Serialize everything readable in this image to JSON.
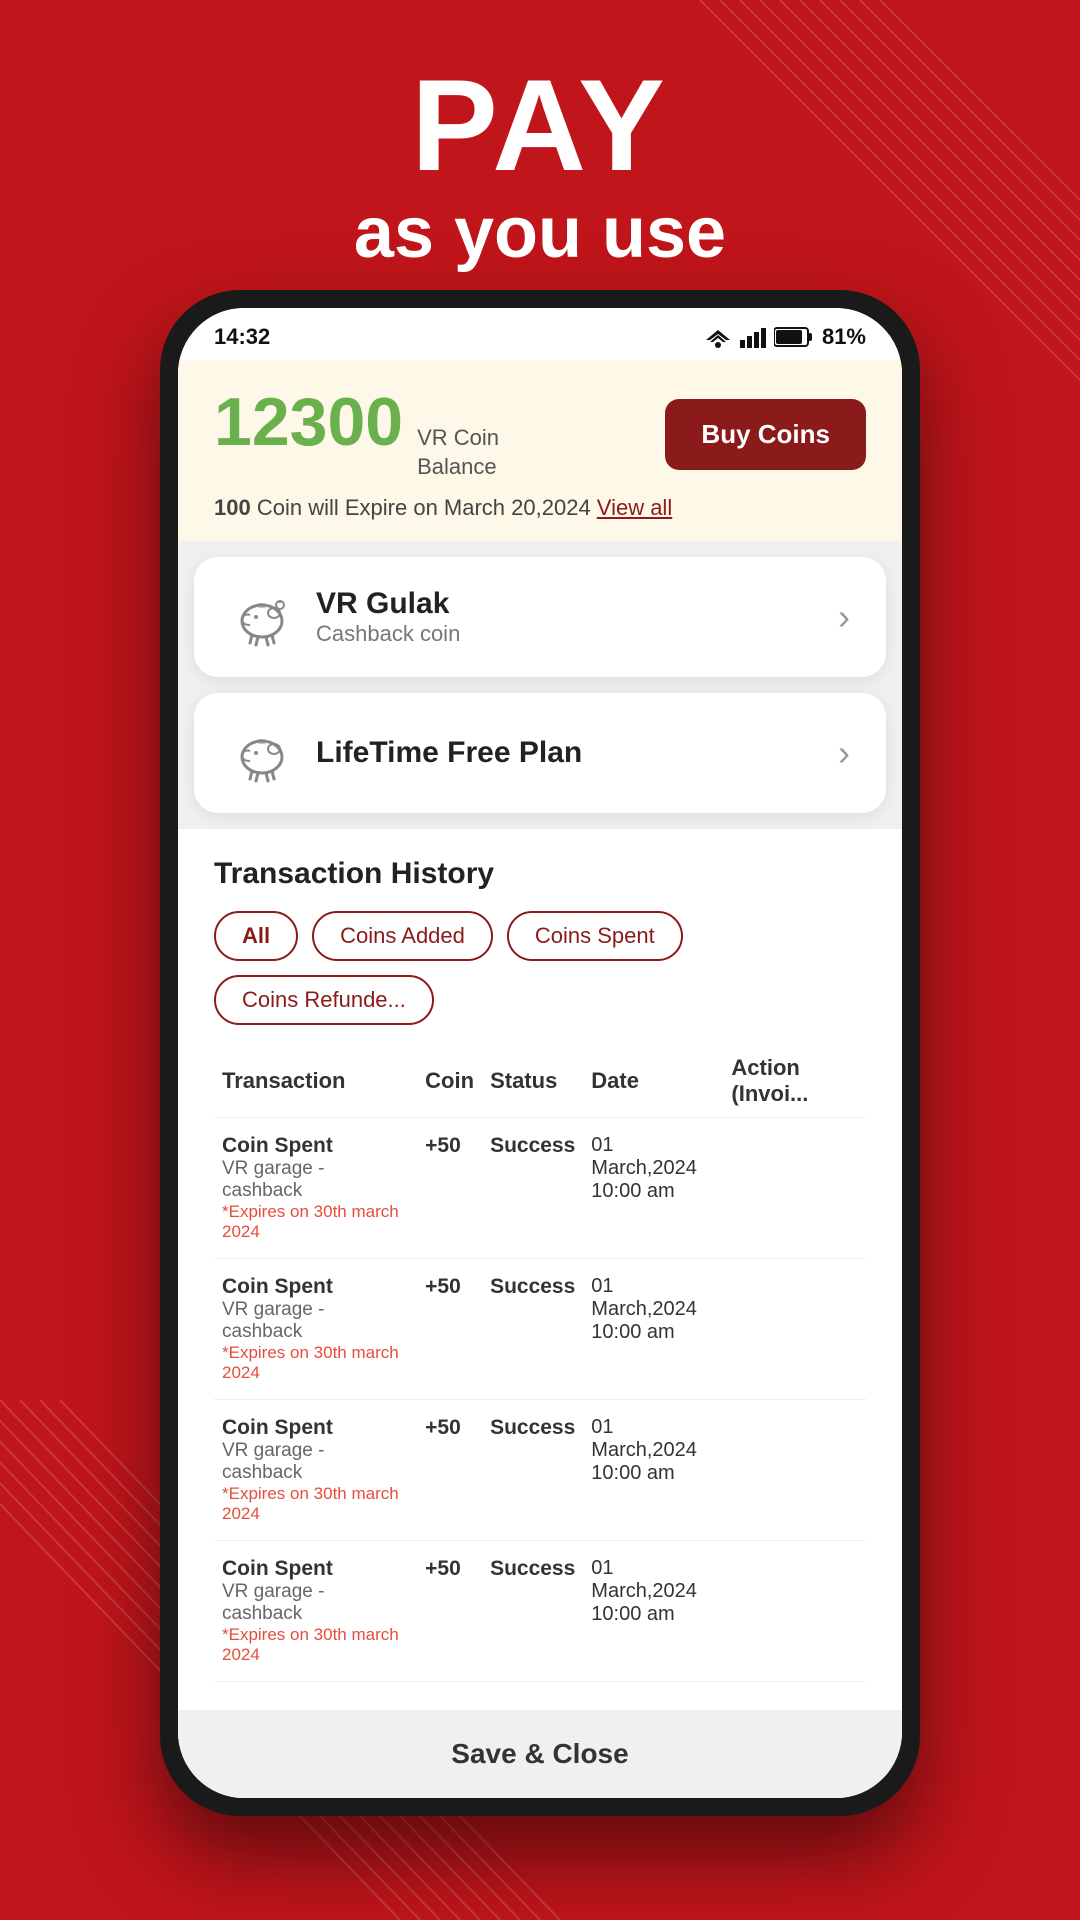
{
  "background": {
    "color": "#c0151a"
  },
  "header": {
    "pay_label": "PAY",
    "subtitle": "as you use"
  },
  "status_bar": {
    "time": "14:32",
    "battery": "81%"
  },
  "coin_balance": {
    "amount": "12300",
    "label_line1": "VR Coin",
    "label_line2": "Balance",
    "buy_coins_label": "Buy Coins",
    "expiry_text_prefix": "100",
    "expiry_text_main": " Coin will Expire on March 20,2024 ",
    "view_all_label": "View all"
  },
  "vr_gulak": {
    "title": "VR Gulak",
    "subtitle": "Cashback coin"
  },
  "lifetime_plan": {
    "title_prefix": "LifeTime ",
    "title_bold": "Free",
    "title_suffix": " Plan"
  },
  "transaction_history": {
    "title": "Transaction History",
    "filters": [
      {
        "label": "All",
        "active": true
      },
      {
        "label": "Coins Added",
        "active": false
      },
      {
        "label": "Coins Spent",
        "active": false
      },
      {
        "label": "Coins Refunde...",
        "active": false
      }
    ],
    "table_headers": {
      "transaction": "Transaction",
      "coin": "Coin",
      "status": "Status",
      "date": "Date",
      "action": "Action (Invoi..."
    },
    "rows": [
      {
        "name": "Coin Spent",
        "sub": "VR garage - cashback",
        "expiry": "*Expires on 30th march 2024",
        "coin": "+50",
        "status": "Success",
        "date": "01 March,2024",
        "time": "10:00 am"
      },
      {
        "name": "Coin Spent",
        "sub": "VR garage - cashback",
        "expiry": "*Expires on 30th march 2024",
        "coin": "+50",
        "status": "Success",
        "date": "01 March,2024",
        "time": "10:00 am"
      },
      {
        "name": "Coin Spent",
        "sub": "VR garage - cashback",
        "expiry": "*Expires on 30th march 2024",
        "coin": "+50",
        "status": "Success",
        "date": "01 March,2024",
        "time": "10:00 am"
      },
      {
        "name": "Coin Spent",
        "sub": "VR garage - cashback",
        "expiry": "*Expires on 30th march 2024",
        "coin": "+50",
        "status": "Success",
        "date": "01 March,2024",
        "time": "10:00 am"
      }
    ]
  },
  "save_close_label": "Save & Close"
}
